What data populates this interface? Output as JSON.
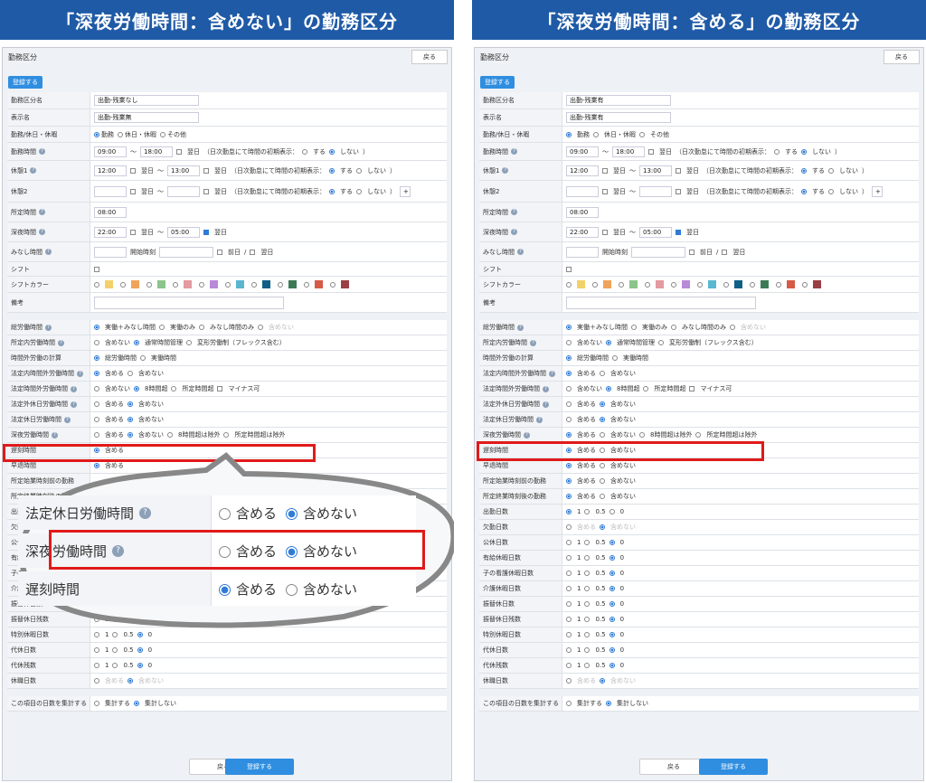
{
  "left": {
    "banner": "「深夜労働時間：含めない」の勤務区分",
    "screen_title": "勤務区分",
    "back": "戻る",
    "register": "登録する",
    "kubun_name": "出勤-残業なし",
    "display_name": "出勤-残業無"
  },
  "right": {
    "banner": "「深夜労働時間：含める」の勤務区分",
    "screen_title": "勤務区分",
    "back": "戻る",
    "register": "登録する",
    "kubun_name": "出勤-残業有",
    "display_name": "出勤-残業有"
  },
  "labels": {
    "kubun_name": "勤務区分名",
    "display_name": "表示名",
    "kind": "勤務/休日・休暇",
    "work_time": "勤務時間",
    "break1": "休憩1",
    "break2": "休憩2",
    "scheduled": "所定時間",
    "night": "深夜時間",
    "deemed": "みなし時間",
    "shift": "シフト",
    "shift_color": "シフトカラー",
    "memo": "備考",
    "total_work": "総労働時間",
    "in_sched_work": "所定内労働時間",
    "out_sched_calc": "時間外労働の計算",
    "legal_in": "法定内時間外労働時間",
    "legal_out": "法定時間外労働時間",
    "legal_off_holiday": "法定外休日労働時間",
    "legal_holiday": "法定休日労働時間",
    "night_work": "深夜労働時間",
    "late": "遅刻時間",
    "early": "早退時間",
    "before_start": "所定始業時刻前の勤務",
    "after_end": "所定終業時刻後の勤務",
    "attend_days": "出勤日数",
    "absent_days": "欠勤日数",
    "public_holiday": "公休日数",
    "paid_leave": "有給休暇日数",
    "child_care": "子の看護休暇日数",
    "nursing": "介護休暇日数",
    "transfer_days": "振替休日数",
    "transfer_rest": "振替休日残数",
    "special_leave": "特別休暇日数",
    "sub_days": "代休日数",
    "sub_rest": "代休残数",
    "leave_days": "休職日数",
    "aggregate": "この項目の日数を集計する"
  },
  "opts": {
    "work": "勤務",
    "holiday": "休日・休暇",
    "other": "その他",
    "next_day": "翌日",
    "prev_day": "前日",
    "tilde": "〜",
    "slash": "/",
    "daily_note": "（日次勤怠にて時間の初期表示：",
    "do": "する",
    "dont": "しない",
    "close": "）",
    "plus": "+",
    "start_time": "開始時刻",
    "actual_deemed": "実働＋みなし時間",
    "actual_only": "実働のみ",
    "deemed_only": "みなし時間のみ",
    "exclude": "含めない",
    "include": "含める",
    "normal_mgmt": "通常時間管理",
    "flex": "変形労働制（フレックス含む）",
    "total_work_opt": "総労働時間",
    "actual_time": "実働時間",
    "over8": "8時間超",
    "over_sched": "所定時間超",
    "minus_ok": "マイナス可",
    "over8_ex": "8時間超は除外",
    "over_sched_ex": "所定時間超は除外",
    "one": "1",
    "half": "0.5",
    "zero": "0",
    "agg_do": "集計する",
    "agg_dont": "集計しない"
  },
  "times": {
    "work_start": "09:00",
    "work_end": "18:00",
    "break_start": "12:00",
    "break_end": "13:00",
    "scheduled": "08:00",
    "night_start": "22:00",
    "night_end": "05:00"
  },
  "colors": {
    "banner": "#1f5aa6",
    "highlight": "#e01a1a",
    "accent": "#2f8ee0",
    "swatches": [
      "#f2d16b",
      "#f0a35a",
      "#8cc48c",
      "#e39aa0",
      "#b98ad8",
      "#5ab7d0",
      "#0f5f86",
      "#3c7a56",
      "#d65a46",
      "#9a3f44"
    ]
  }
}
